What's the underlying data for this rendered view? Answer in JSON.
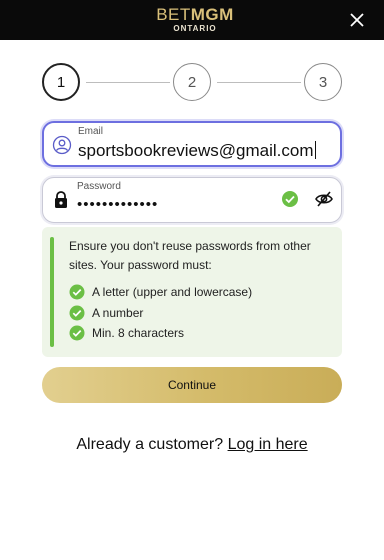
{
  "header": {
    "logo_bet": "BET",
    "logo_mgm": "MGM",
    "logo_sub": "ONTARIO",
    "close_icon": "close-icon"
  },
  "stepper": {
    "steps": [
      "1",
      "2",
      "3"
    ],
    "active_step": 1
  },
  "email": {
    "label": "Email",
    "value": "sportsbookreviews@gmail.com",
    "icon": "user-icon"
  },
  "password": {
    "label": "Password",
    "value": "•••••••••••••",
    "icon": "lock-icon",
    "valid_icon": "check-circle-icon",
    "toggle_icon": "eye-off-icon"
  },
  "rules": {
    "intro": "Ensure you don't reuse passwords from other sites. Your password must:",
    "items": [
      "A letter (upper and lowercase)",
      "A number",
      "Min. 8 characters"
    ],
    "accent_color": "#6bbf45"
  },
  "continue_label": "Continue",
  "login": {
    "prompt": "Already a customer?",
    "link": "Log in here"
  },
  "colors": {
    "brand_gold": "#d9c07a",
    "focus_border": "#6d6fe0",
    "success": "#6bbf45"
  }
}
